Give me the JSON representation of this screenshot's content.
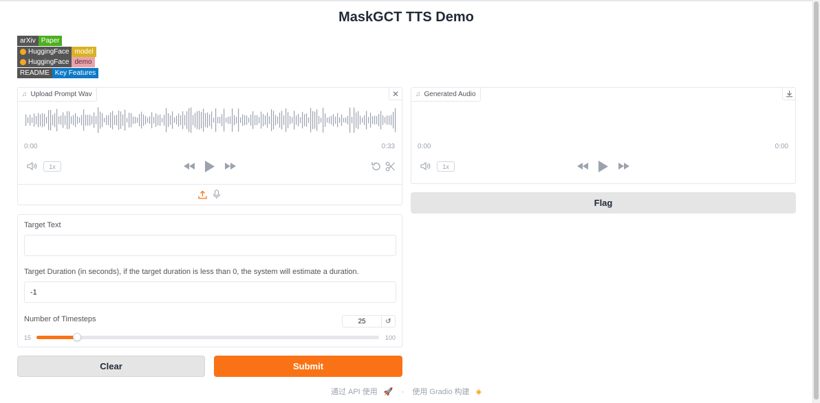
{
  "title": "MaskGCT TTS Demo",
  "badges": [
    {
      "left": "arXiv",
      "right": "Paper",
      "right_color": "#4caf1f",
      "hf": false
    },
    {
      "left": "HuggingFace",
      "right": "model",
      "right_color": "#d9b225",
      "hf": true
    },
    {
      "left": "HuggingFace",
      "right": "demo",
      "right_color": "#e9a3ad",
      "hf": true
    },
    {
      "left": "README",
      "right": "Key Features",
      "right_color": "#0e79c6",
      "hf": false
    }
  ],
  "prompt_audio": {
    "label": "Upload Prompt Wav",
    "time_start": "0:00",
    "time_end": "0:33",
    "rate": "1x"
  },
  "generated_audio": {
    "label": "Generated Audio",
    "time_start": "0:00",
    "time_end": "0:00",
    "rate": "1x"
  },
  "flag_label": "Flag",
  "target_text": {
    "label": "Target Text",
    "value": ""
  },
  "target_duration": {
    "label": "Target Duration (in seconds), if the target duration is less than 0, the system will estimate a duration.",
    "value": "-1"
  },
  "timesteps": {
    "label": "Number of Timesteps",
    "value": "25",
    "min": "15",
    "max": "100",
    "level": 25
  },
  "clear_label": "Clear",
  "submit_label": "Submit",
  "footer": {
    "api_text": "通过 API 使用",
    "separator": "·",
    "built_text": "使用 Gradio 构建"
  },
  "colors": {
    "accent": "#f97316",
    "button_gray": "#e5e5e5"
  }
}
